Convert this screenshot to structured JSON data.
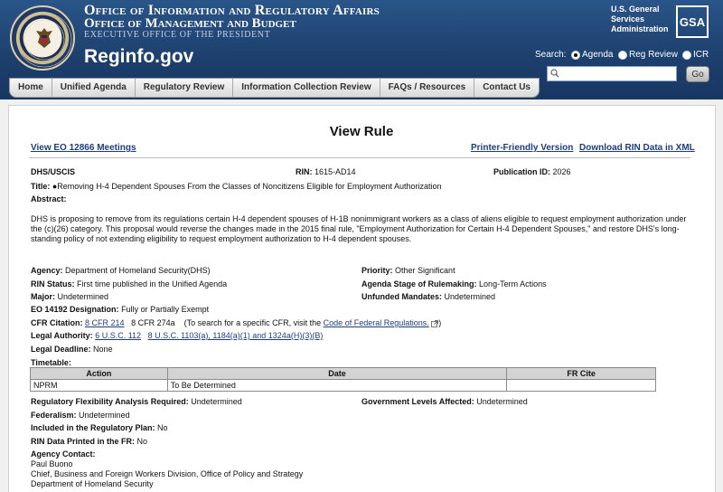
{
  "header": {
    "org_line1": "Office of Information and Regulatory Affairs",
    "org_line2": "Office of Management and Budget",
    "org_line3": "EXECUTIVE OFFICE OF THE PRESIDENT",
    "site_name": "Reginfo.gov",
    "gsa_text": [
      "U.S. General",
      "Services",
      "Administration"
    ],
    "gsa_logo": "GSA",
    "search_label": "Search:",
    "search_options": [
      {
        "label": "Agenda",
        "selected": true
      },
      {
        "label": "Reg Review",
        "selected": false
      },
      {
        "label": "ICR",
        "selected": false
      }
    ],
    "search_value": "",
    "go_label": "Go"
  },
  "nav": [
    "Home",
    "Unified Agenda",
    "Regulatory Review",
    "Information Collection Review",
    "FAQs / Resources",
    "Contact Us"
  ],
  "page": {
    "title": "View Rule",
    "link_meetings": "View EO 12866 Meetings",
    "link_printer": "Printer-Friendly Version",
    "link_download": "Download RIN Data in XML"
  },
  "rule": {
    "agency_code": "DHS/USCIS",
    "rin_label": "RIN:",
    "rin": "1615-AD14",
    "pubid_label": "Publication ID:",
    "pubid": "2026",
    "title_label": "Title:",
    "title": "●Removing H-4 Dependent Spouses From the Classes of Noncitizens Eligible for Employment Authorization",
    "abstract_label": "Abstract:",
    "abstract": "DHS is proposing to remove from its regulations certain H-4 dependent spouses of H-1B nonimmigrant workers as a class of aliens eligible to request employment authorization under the (c)(26) category. This proposal would reverse the changes made in the 2015 final rule, \"Employment Authorization for Certain H-4 Dependent Spouses,\" and restore DHS's long-standing policy of not extending eligibility to request employment authorization to H-4 dependent spouses.",
    "agency_label": "Agency:",
    "agency": "Department of Homeland Security(DHS)",
    "priority_label": "Priority:",
    "priority": "Other Significant",
    "rin_status_label": "RIN Status:",
    "rin_status": "First time published in the Unified Agenda",
    "stage_label": "Agenda Stage of Rulemaking:",
    "stage": "Long-Term Actions",
    "major_label": "Major:",
    "major": "Undetermined",
    "unfunded_label": "Unfunded Mandates:",
    "unfunded": "Undetermined",
    "eo_label": "EO 14192 Designation:",
    "eo": "Fully or Partially Exempt",
    "cfr_label": "CFR Citation:",
    "cfr_link": "8 CFR 214",
    "cfr_other": "8 CFR 274a",
    "cfr_hint_pre": "(To search for a specific CFR, visit the",
    "cfr_hint_link": "Code of Federal Regulations.",
    "cfr_hint_post": ")",
    "legal_label": "Legal Authority:",
    "legal_link1": "6 U.S.C. 112",
    "legal_link2": "8 U.S.C. 1103(a), 1184(a)(1) and 1324a(H)(3)(B)",
    "deadline_label": "Legal Deadline:",
    "deadline": "None",
    "timetable_label": "Timetable:",
    "timetable_headers": [
      "Action",
      "Date",
      "FR Cite"
    ],
    "timetable_rows": [
      [
        "NPRM",
        "To Be Determined",
        ""
      ]
    ],
    "rfa_label": "Regulatory Flexibility Analysis Required:",
    "rfa": "Undetermined",
    "gov_label": "Government Levels Affected:",
    "gov": "Undetermined",
    "federalism_label": "Federalism:",
    "federalism": "Undetermined",
    "plan_label": "Included in the Regulatory Plan:",
    "plan": "No",
    "printed_label": "RIN Data Printed in the FR:",
    "printed": "No",
    "contact_label": "Agency Contact:",
    "contact_name": "Paul Buono",
    "contact_title": "Chief, Business and Foreign Workers Division, Office of Policy and Strategy",
    "contact_org": "Department of Homeland Security"
  }
}
